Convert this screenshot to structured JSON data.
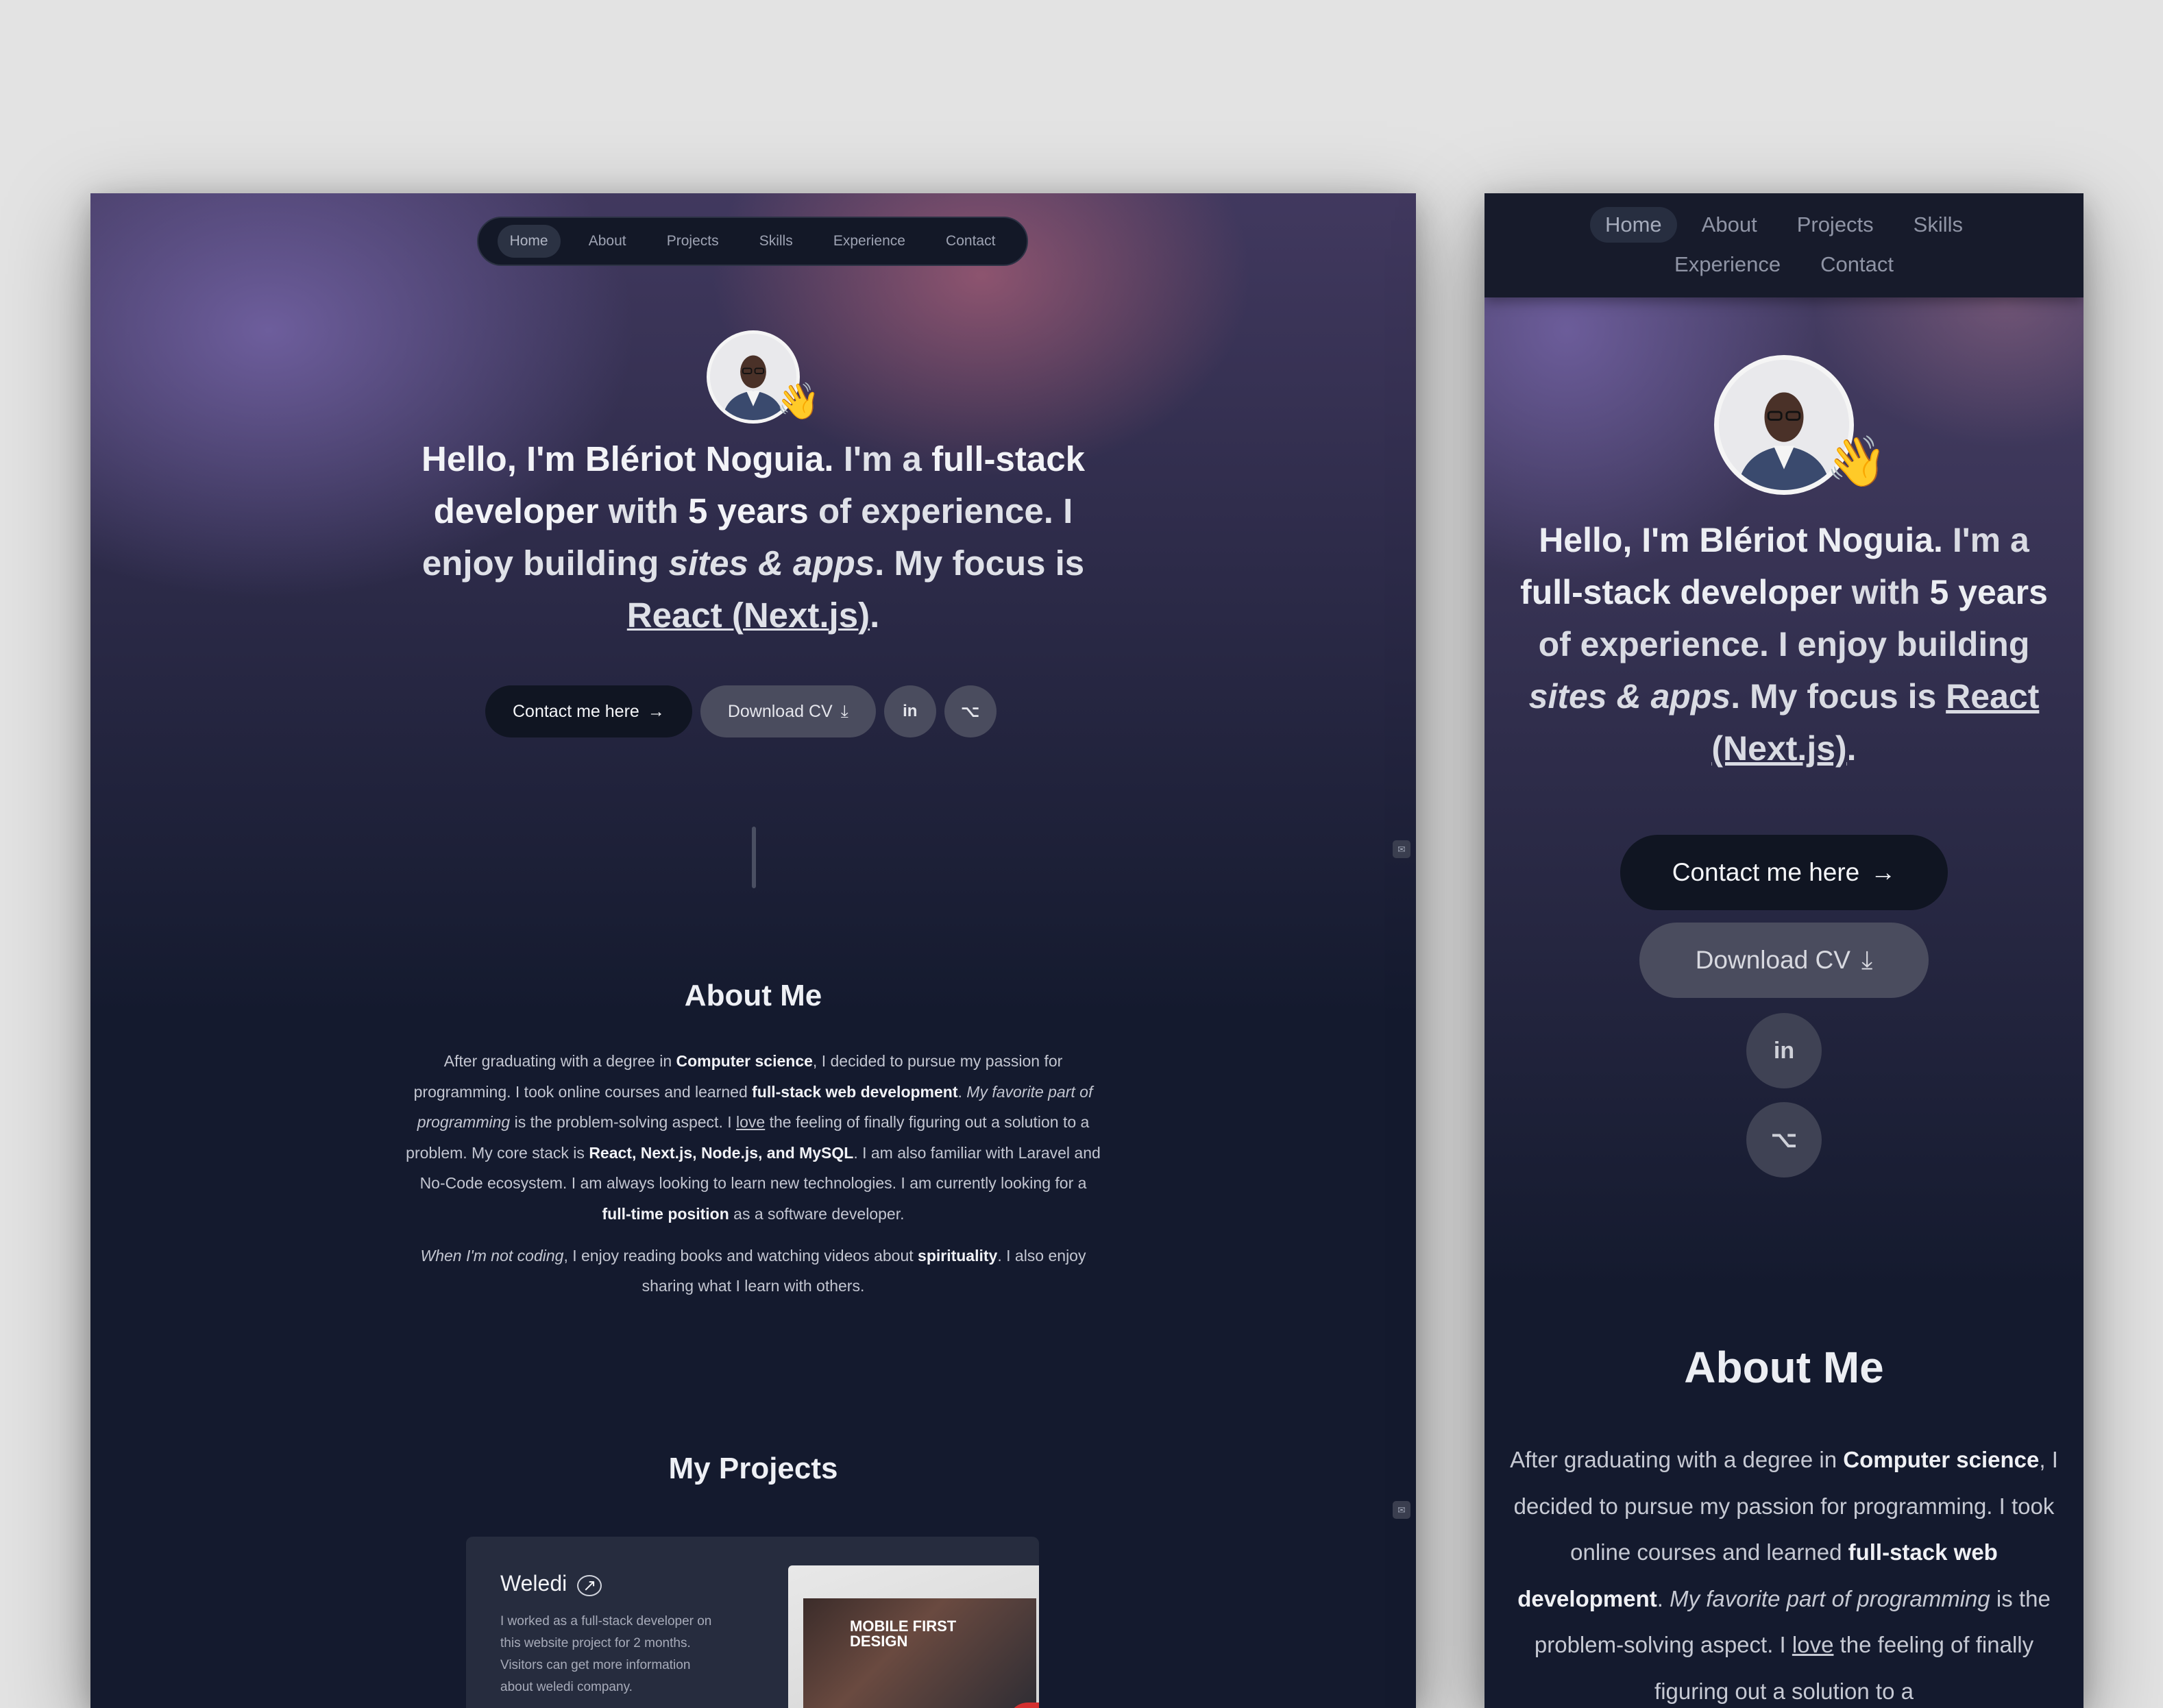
{
  "nav": {
    "items": [
      {
        "label": "Home",
        "active": true
      },
      {
        "label": "About"
      },
      {
        "label": "Projects"
      },
      {
        "label": "Skills"
      },
      {
        "label": "Experience"
      },
      {
        "label": "Contact"
      }
    ]
  },
  "hero": {
    "greeting_bold": "Hello, I'm Blériot Noguia.",
    "text_1": " I'm a ",
    "role_bold": "full-stack developer",
    "text_2": " with ",
    "years_bold": "5 years",
    "text_3": " of experience. I enjoy building ",
    "italic": "sites & apps",
    "text_4": ". My focus is ",
    "focus_link": "React (Next.js)",
    "text_5": ".",
    "wave_emoji": "👋",
    "avatar_icon": "profile-photo-icon"
  },
  "buttons": {
    "contact_label": "Contact me here",
    "contact_arrow": "→",
    "cv_label": "Download CV",
    "cv_icon": "⤓",
    "linkedin_glyph": "in",
    "github_glyph": "⌥"
  },
  "about": {
    "title": "About Me",
    "p1_a": "After graduating with a degree in ",
    "p1_b": "Computer science",
    "p1_c": ", I decided to pursue my passion for programming. I took online courses and learned ",
    "p1_d": "full-stack web development",
    "p1_e": ". ",
    "p1_f": "My favorite part of programming",
    "p1_g": " is the problem-solving aspect. I ",
    "p1_h": "love",
    "p1_i": " the feeling of finally figuring out a solution to a problem. My core stack is ",
    "p1_j": "React, Next.js, Node.js, and MySQL",
    "p1_k": ". I am also familiar with Laravel and No-Code ecosystem. I am always looking to learn new technologies. I am currently looking for a ",
    "p1_l": "full-time position",
    "p1_m": " as a software developer.",
    "p2_a": "When I'm not coding",
    "p2_b": ", I enjoy reading books and watching videos about ",
    "p2_c": "spirituality",
    "p2_d": ". I also enjoy sharing what I learn with others.",
    "mobile_p1_a": "After graduating with a degree in ",
    "mobile_p1_b": "Computer science",
    "mobile_p1_c": ", I decided to pursue my passion for programming. I took online courses and learned ",
    "mobile_p1_d": "full-stack web development",
    "mobile_p1_e": ". ",
    "mobile_p1_f": "My favorite part of programming",
    "mobile_p1_g": " is the problem-solving aspect. I ",
    "mobile_p1_h": "love",
    "mobile_p1_i": " the feeling of finally figuring out a solution to a"
  },
  "projects": {
    "title": "My Projects",
    "items": [
      {
        "name": "Weledi",
        "link_icon": "↗",
        "description": "I worked as a full-stack developer on this website project for 2 months. Visitors can get more information about weledi company.",
        "image_text": "MOBILE FIRST DESIGN"
      }
    ]
  },
  "side_icon": "✉"
}
